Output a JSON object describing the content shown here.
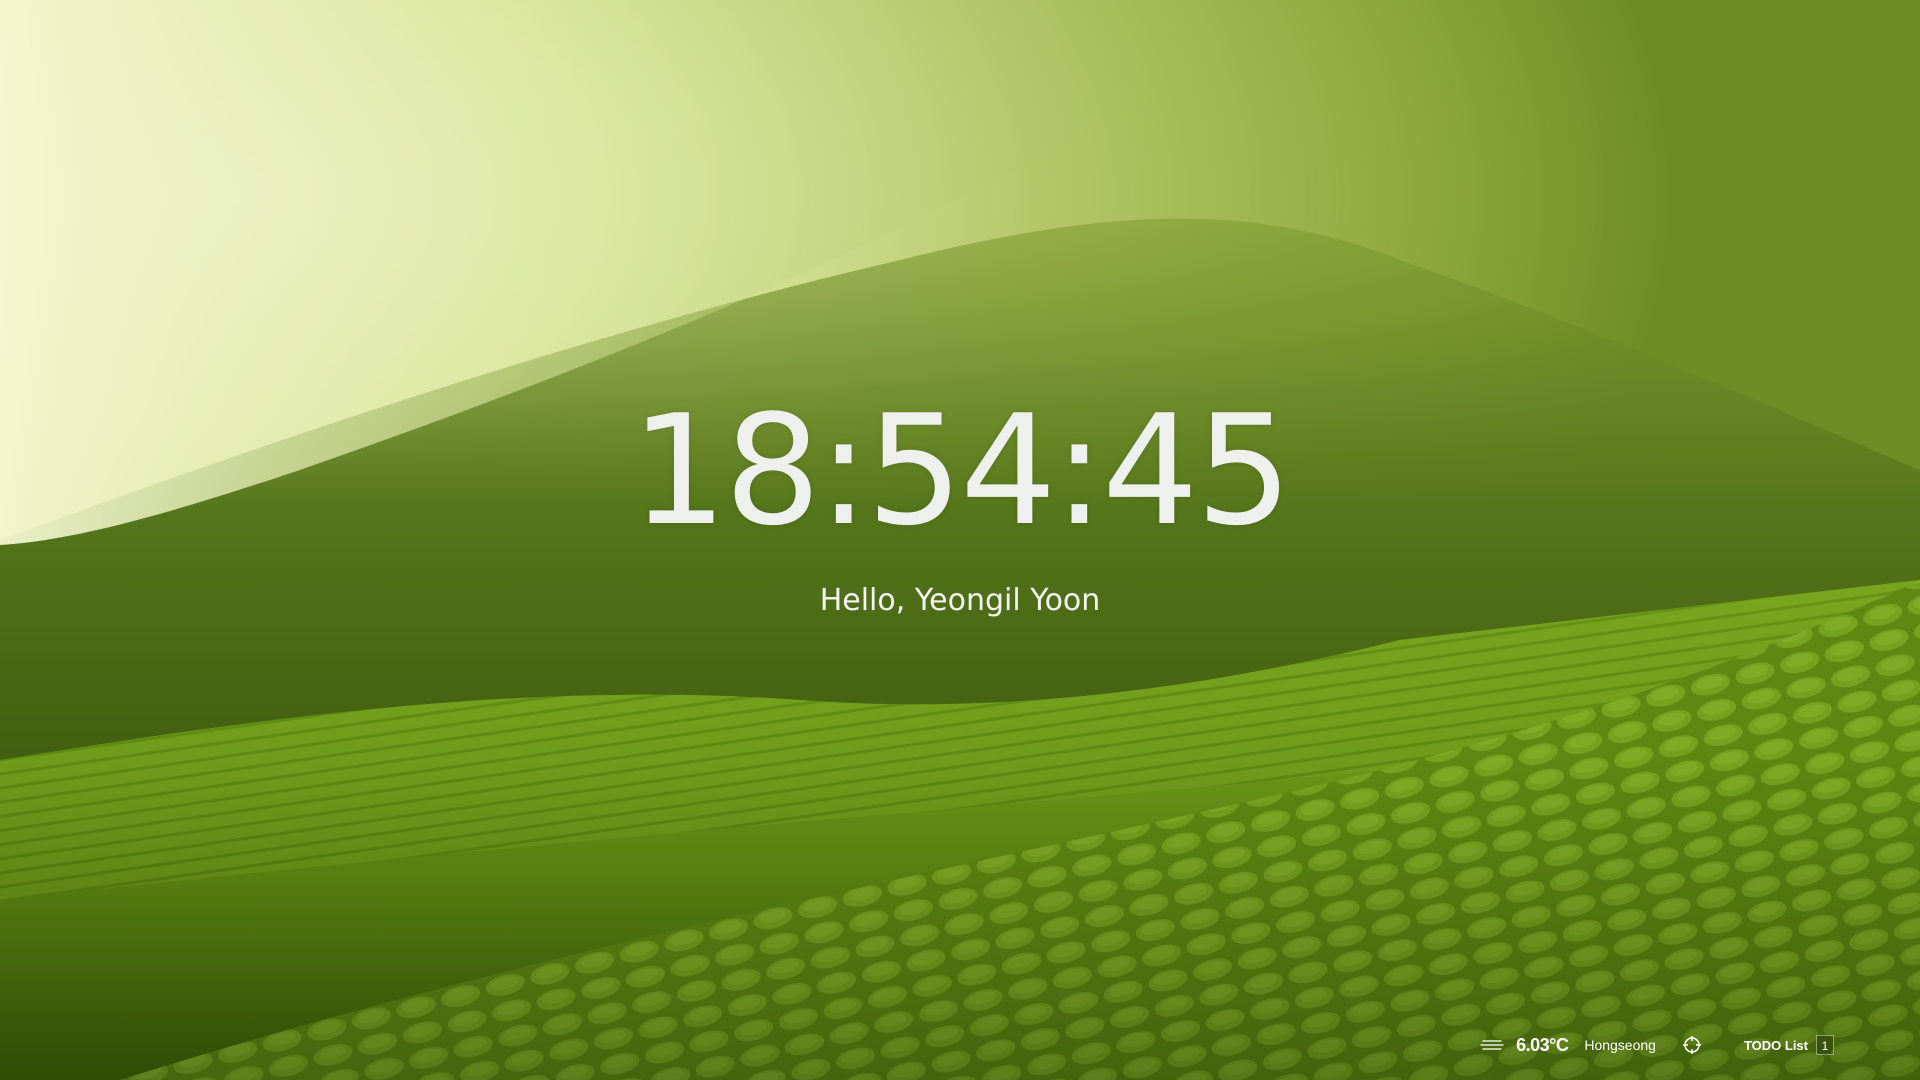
{
  "clock": {
    "time": "18:54:45"
  },
  "greeting": {
    "text": "Hello, Yeongil Yoon"
  },
  "weather": {
    "icon": "haze-icon",
    "temperature": "6.03°C",
    "location": "Hongseong"
  },
  "locate": {
    "icon": "crosshair-icon"
  },
  "todo": {
    "label": "TODO List",
    "count": "1"
  },
  "colors": {
    "fog": "#f4f7d2",
    "hill_dark": "#3f5f12",
    "field": "#6c9a1a",
    "text": "#f2f2f2"
  }
}
